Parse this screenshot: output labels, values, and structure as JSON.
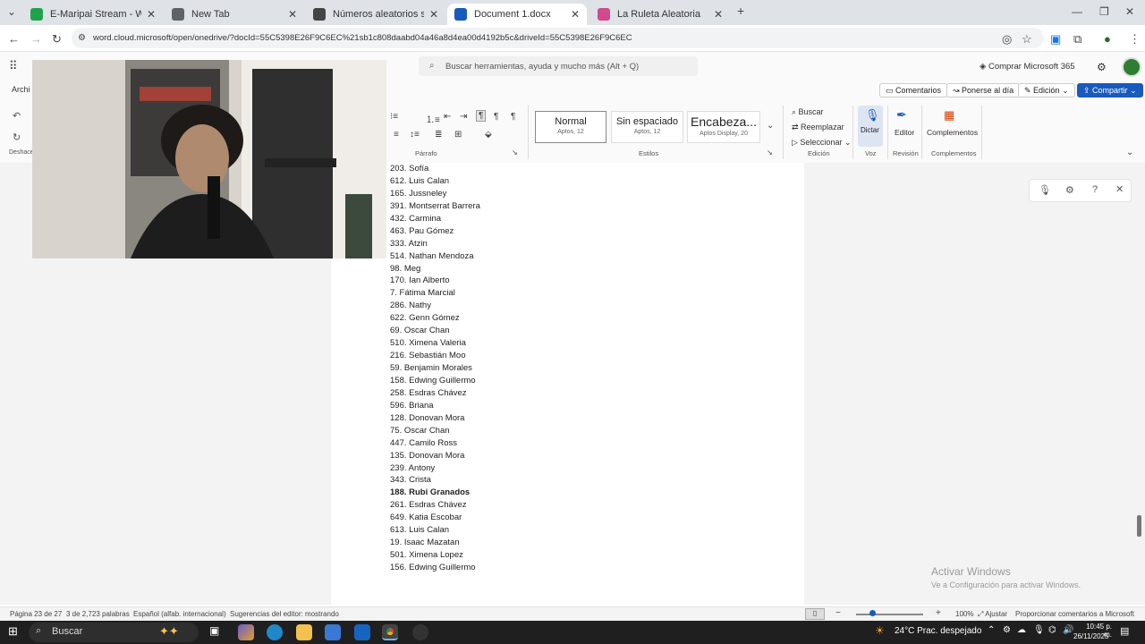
{
  "browser": {
    "tabs": [
      {
        "label": "E-Maripai Stream - Watch Live",
        "color": "#1ea34a",
        "active": false
      },
      {
        "label": "New Tab",
        "color": "#5f6368",
        "active": false
      },
      {
        "label": "Números aleatorios seleccionados",
        "color": "#444",
        "active": false
      },
      {
        "label": "Document 1.docx",
        "color": "#185abd",
        "active": true
      },
      {
        "label": "La Ruleta Aleatoria",
        "color": "#d04a8c",
        "active": false
      }
    ],
    "url": "word.cloud.microsoft/open/onedrive/?docId=55C5398E26F9C6EC%21sb1c808daabd04a46a8d4ea00d4192b5c&driveId=55C5398E26F9C6EC"
  },
  "word": {
    "search_placeholder": "Buscar herramientas, ayuda y mucho más (Alt + Q)",
    "buy_label": "Comprar Microsoft 365",
    "left_menu_label": "Archi",
    "left_undo_label": "Deshace",
    "comments_label": "Comentarios",
    "catchup_label": "Ponerse al día",
    "editing_label": "Edición",
    "share_label": "Compartir",
    "styles": [
      {
        "name": "Normal",
        "font": "Aptos, 12"
      },
      {
        "name": "Sin espaciado",
        "font": "Aptos, 12"
      },
      {
        "name": "Encabeza...",
        "font": "Aptos Display, 20"
      }
    ],
    "group_paragraph": "Párrafo",
    "group_styles": "Estilos",
    "find_label": "Buscar",
    "replace_label": "Reemplazar",
    "select_label": "Seleccionar",
    "group_edit": "Edición",
    "dictate_label": "Dictar",
    "group_voice": "Voz",
    "editor_label": "Editor",
    "group_review": "Revisión",
    "addins_label": "Complementos",
    "group_addins": "Complementos"
  },
  "document": {
    "lines": [
      {
        "text": "203. Sofía",
        "bold": false
      },
      {
        "text": "612. Luis Calan",
        "bold": false
      },
      {
        "text": "165. Jussneley",
        "bold": false
      },
      {
        "text": "391. Montserrat Barrera",
        "bold": false
      },
      {
        "text": "432. Carmina",
        "bold": false
      },
      {
        "text": "463. Pau Gómez",
        "bold": false
      },
      {
        "text": "333. Atzin",
        "bold": false
      },
      {
        "text": "514. Nathan Mendoza",
        "bold": false
      },
      {
        "text": "98. Meg",
        "bold": false
      },
      {
        "text": "170. Ian Alberto",
        "bold": false
      },
      {
        "text": "7. Fátima Marcial",
        "bold": false
      },
      {
        "text": "286. Nathy",
        "bold": false
      },
      {
        "text": "622. Genn Gómez",
        "bold": false
      },
      {
        "text": "69. Oscar Chan",
        "bold": false
      },
      {
        "text": "510. Ximena Valeria",
        "bold": false
      },
      {
        "text": "216. Sebastián Moo",
        "bold": false
      },
      {
        "text": "59. Benjamin Morales",
        "bold": false
      },
      {
        "text": "158. Edwing Guillermo",
        "bold": false
      },
      {
        "text": "258. Esdras Chávez",
        "bold": false
      },
      {
        "text": "596. Briana",
        "bold": false
      },
      {
        "text": "128. Donovan Mora",
        "bold": false
      },
      {
        "text": "75. Oscar Chan",
        "bold": false
      },
      {
        "text": "447. Camilo Ross",
        "bold": false
      },
      {
        "text": "135. Donovan Mora",
        "bold": false
      },
      {
        "text": "239. Antony",
        "bold": false
      },
      {
        "text": "343. Crista",
        "bold": false
      },
      {
        "text": "188. Rubi Granados",
        "bold": true
      },
      {
        "text": "261. Esdras Chávez",
        "bold": false
      },
      {
        "text": "649. Katia Escobar",
        "bold": false
      },
      {
        "text": "613. Luis Calan",
        "bold": false
      },
      {
        "text": "19. Isaac Mazatan",
        "bold": false
      },
      {
        "text": "501. Ximena Lopez",
        "bold": false
      },
      {
        "text": "156. Edwing Guillermo",
        "bold": false
      }
    ]
  },
  "watermark": {
    "title": "Activar Windows",
    "subtitle": "Ve a Configuración para activar Windows."
  },
  "status": {
    "page": "Página 23 de 27",
    "words": "3 de 2,723 palabras",
    "language": "Español (alfab. internacional)",
    "suggestions": "Sugerencias del editor: mostrando",
    "zoom": "100%",
    "fit": "Ajustar",
    "feedback": "Proporcionar comentarios a Microsoft"
  },
  "taskbar": {
    "search_label": "Buscar",
    "weather": "24°C Prac. despejado",
    "time": "10:45 p. m.",
    "date": "26/11/2025"
  }
}
